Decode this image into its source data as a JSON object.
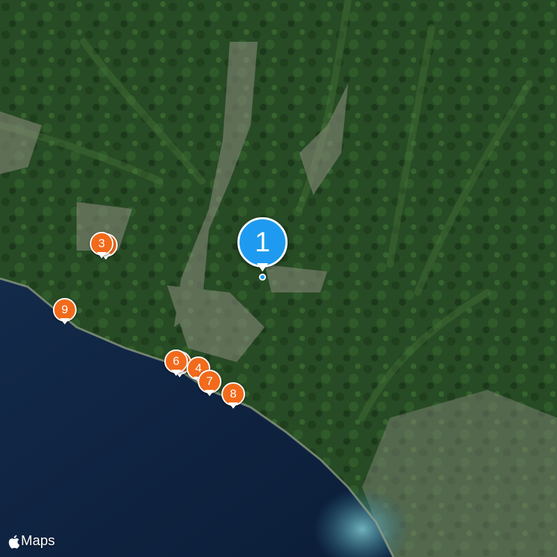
{
  "map": {
    "style": "satellite",
    "colors": {
      "sea_deep": "#0d2240",
      "sea_shallow": "#4e9aa6",
      "forest": "#254a22",
      "forest_light": "#3c6a33",
      "urban": "#8d8f7f"
    }
  },
  "markers": {
    "primary": {
      "label": "1",
      "color": "#1e9bf0"
    },
    "pins": [
      {
        "label": "3",
        "color": "#f26a1b"
      },
      {
        "label": "9",
        "color": "#f26a1b"
      },
      {
        "label": "6",
        "color": "#f26a1b"
      },
      {
        "label": "4",
        "color": "#f26a1b"
      },
      {
        "label": "7",
        "color": "#f26a1b"
      },
      {
        "label": "8",
        "color": "#f26a1b"
      }
    ]
  },
  "attribution": {
    "icon": "apple-logo-icon",
    "text": "Maps"
  }
}
